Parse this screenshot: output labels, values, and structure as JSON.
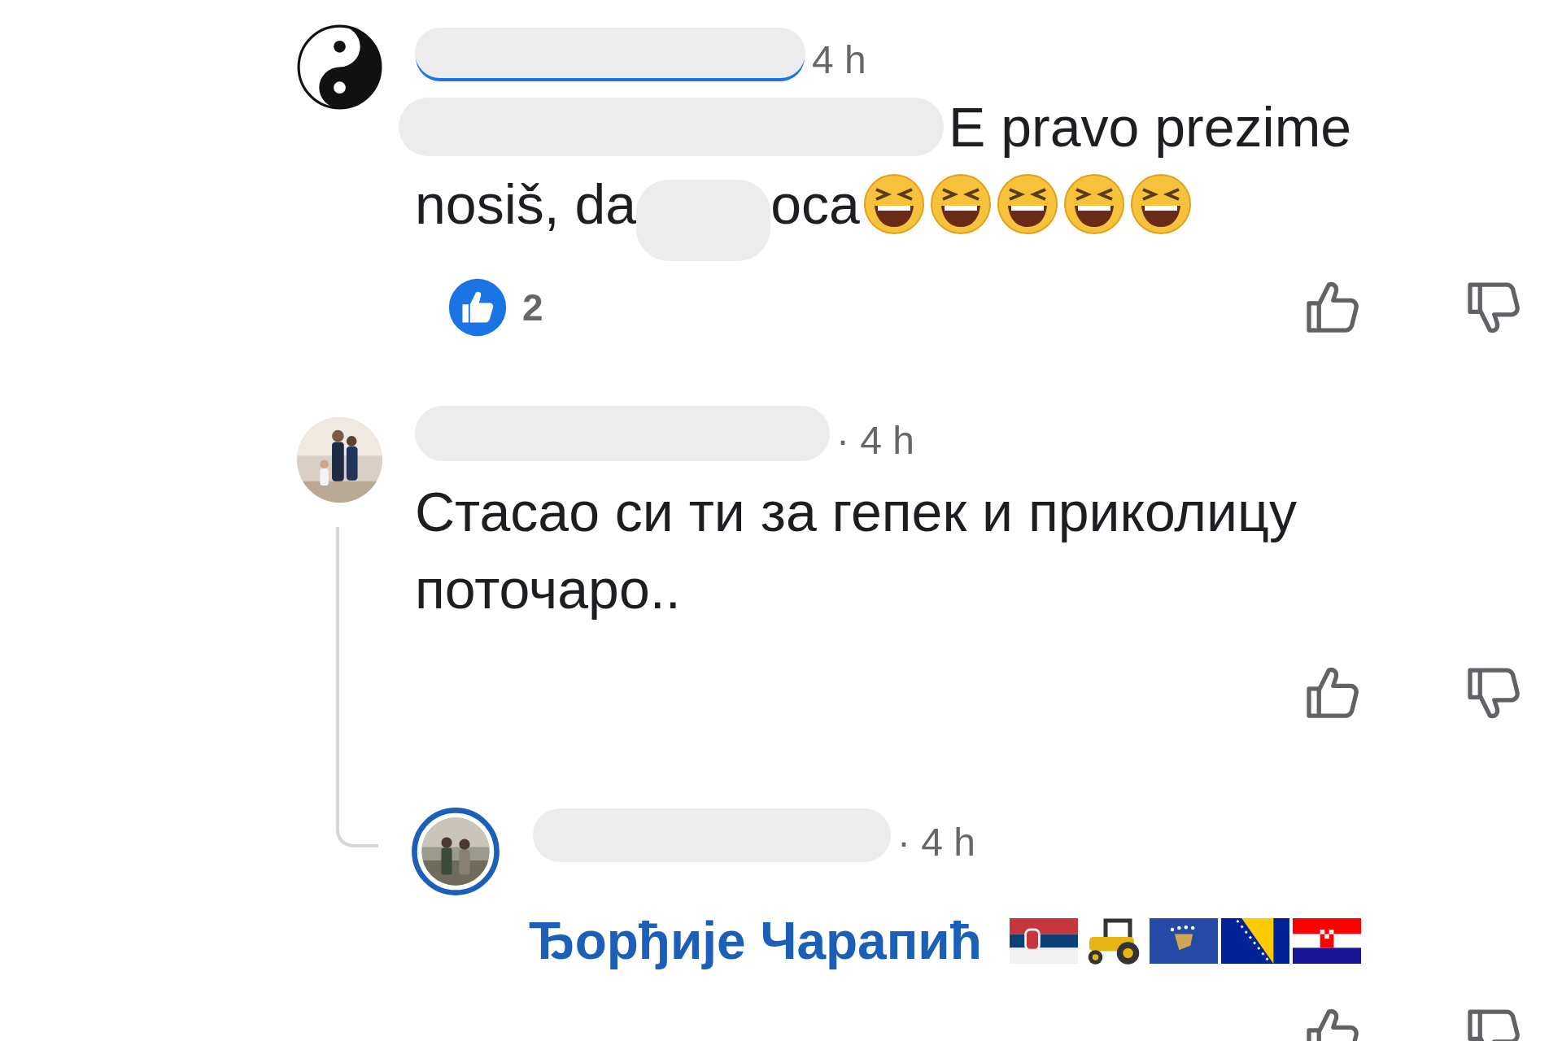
{
  "comments": [
    {
      "time": "4 h",
      "text": [
        "E pravo prezime",
        "nosiš, da",
        "oca"
      ],
      "reactions": {
        "count": "2"
      }
    },
    {
      "time": "· 4 h",
      "text": "Стасао си ти за гепек и приколицу поточаро..",
      "replies": [
        {
          "time": "· 4 h",
          "mention": "Ђорђије Чарапић"
        }
      ]
    }
  ]
}
